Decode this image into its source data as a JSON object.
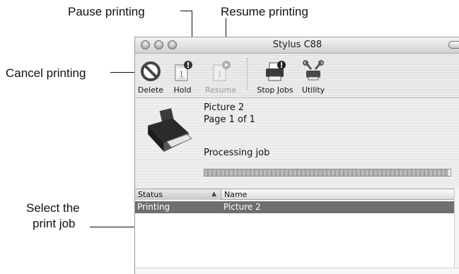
{
  "callouts": {
    "pause": "Pause printing",
    "resume": "Resume printing",
    "cancel": "Cancel printing",
    "select_line1": "Select the",
    "select_line2": "print job"
  },
  "window": {
    "title": "Stylus C88"
  },
  "toolbar": {
    "delete_label": "Delete",
    "hold_label": "Hold",
    "resume_label": "Resume",
    "stop_jobs_label": "Stop Jobs",
    "utility_label": "Utility"
  },
  "job_info": {
    "name": "Picture 2",
    "page": "Page 1 of 1",
    "status": "Processing job",
    "progress": 0.99
  },
  "jobs_table": {
    "columns": [
      "Status",
      "Name"
    ],
    "rows": [
      {
        "status": "Printing",
        "name": "Picture 2",
        "selected": true
      }
    ]
  },
  "colors": {
    "selected_row": "#6f6f6f",
    "callout_text": "#111111"
  }
}
